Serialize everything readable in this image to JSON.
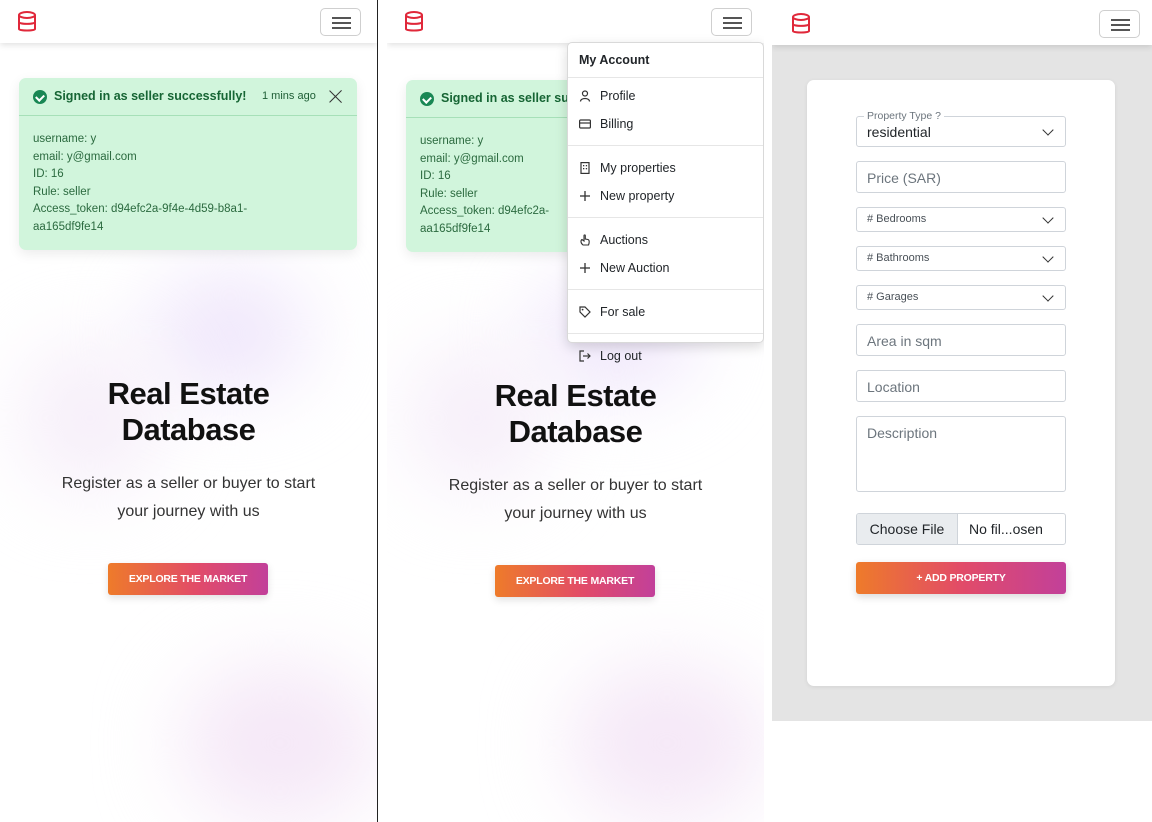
{
  "colors": {
    "brand": "#e0283a",
    "toast_bg": "#d1f5dc",
    "toast_text": "#2b6a3f",
    "success": "#198754",
    "gradient_start": "#ee7b2a",
    "gradient_end": "#c2409a",
    "page_gray": "#e4e4e4"
  },
  "icons": {
    "logo": "database-icon",
    "menu": "hamburger-icon",
    "success": "check-circle-icon",
    "close": "close-icon",
    "chevron": "chevron-down-icon"
  },
  "toast": {
    "title": "Signed in as seller successfully!",
    "title_partial": "Signed in as seller su",
    "time": "1 mins ago",
    "lines": [
      "username: y",
      "email: y@gmail.com",
      "ID: 16",
      "Rule: seller",
      "Access_token: d94efc2a-9f4e-4d59-b8a1-",
      "aa165df9fe14"
    ],
    "lines_partial": [
      "username: y",
      "email: y@gmail.com",
      "ID: 16",
      "Rule: seller",
      "Access_token: d94efc2a-",
      "aa165df9fe14"
    ]
  },
  "hero": {
    "title_line1": "Real Estate",
    "title_line2": "Database",
    "subtitle_line1": "Register as a seller or buyer to start",
    "subtitle_line2": "your journey with us",
    "cta_label": "EXPLORE THE MARKET"
  },
  "account_menu": {
    "header": "My Account",
    "items": [
      {
        "label": "Profile",
        "icon": "user-icon"
      },
      {
        "label": "Billing",
        "icon": "credit-card-icon"
      },
      {
        "label": "My properties",
        "icon": "building-icon"
      },
      {
        "label": "New property",
        "icon": "plus-icon"
      },
      {
        "label": "Auctions",
        "icon": "hand-icon"
      },
      {
        "label": "New Auction",
        "icon": "plus-icon"
      },
      {
        "label": "For sale",
        "icon": "tag-icon"
      },
      {
        "label": "Log out",
        "icon": "logout-icon"
      }
    ]
  },
  "property_form": {
    "type_label": "Property Type ?",
    "type_value": "residential",
    "price_placeholder": "Price (SAR)",
    "bedrooms_placeholder": "# Bedrooms",
    "bathrooms_placeholder": "# Bathrooms",
    "garages_placeholder": "# Garages",
    "area_placeholder": "Area in sqm",
    "location_placeholder": "Location",
    "description_placeholder": "Description",
    "file_button": "Choose File",
    "file_status": "No fil...osen",
    "submit_label": "+ ADD PROPERTY"
  }
}
